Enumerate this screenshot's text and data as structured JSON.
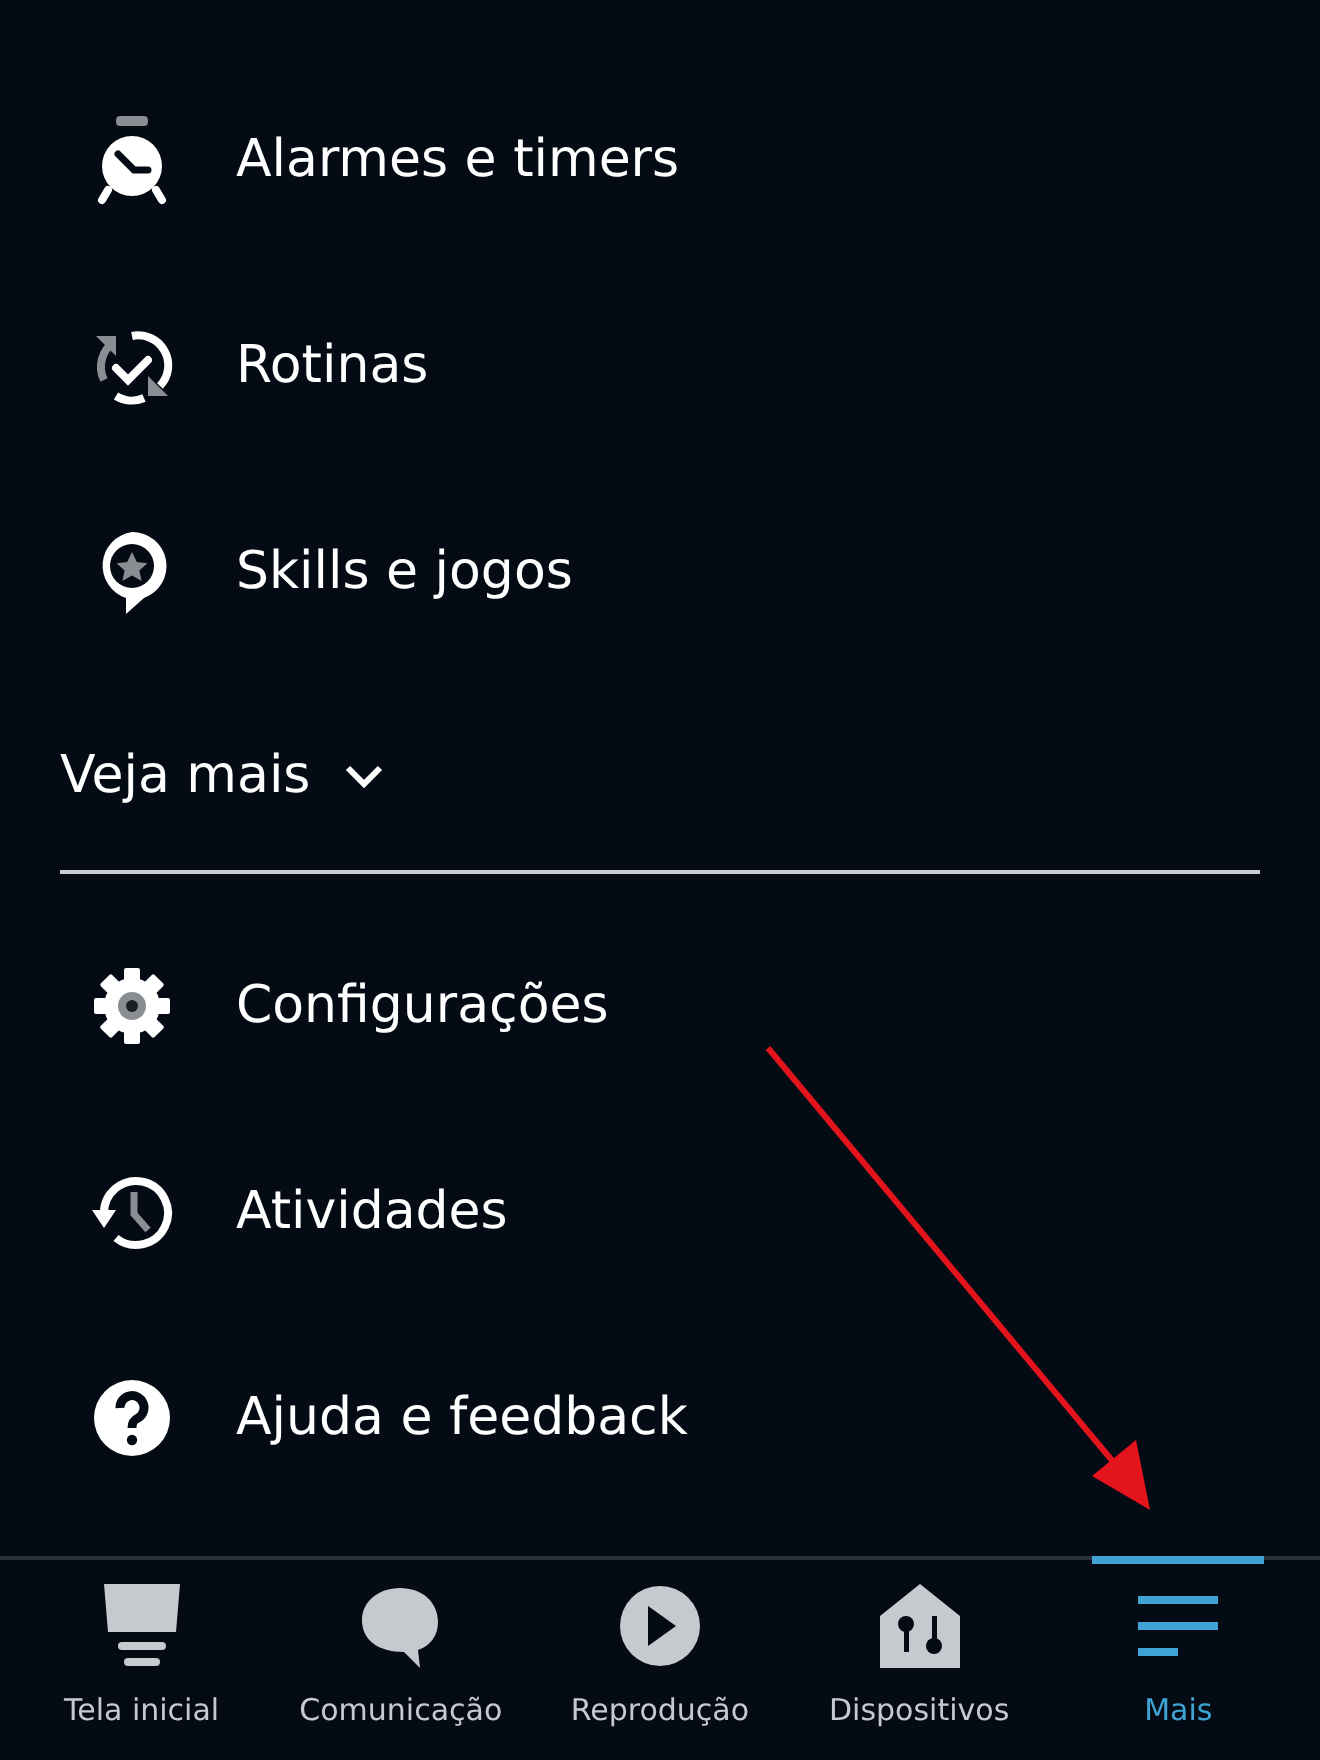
{
  "menu_top": [
    {
      "kind": "alarm",
      "label": "Alarmes e timers"
    },
    {
      "kind": "routine",
      "label": "Rotinas"
    },
    {
      "kind": "skills",
      "label": "Skills e jogos"
    }
  ],
  "see_more": {
    "label": "Veja mais",
    "expanded": false
  },
  "menu_bottom": [
    {
      "kind": "settings",
      "label": "Configurações"
    },
    {
      "kind": "history",
      "label": "Atividades"
    },
    {
      "kind": "help",
      "label": "Ajuda e feedback"
    }
  ],
  "bottom_nav": [
    {
      "kind": "home",
      "label": "Tela inicial",
      "selected": false
    },
    {
      "kind": "chat",
      "label": "Comunicação",
      "selected": false
    },
    {
      "kind": "play",
      "label": "Reprodução",
      "selected": false
    },
    {
      "kind": "devices",
      "label": "Dispositivos",
      "selected": false
    },
    {
      "kind": "more",
      "label": "Mais",
      "selected": true
    }
  ]
}
